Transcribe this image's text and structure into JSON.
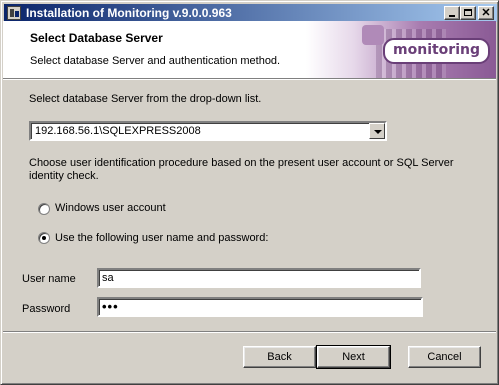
{
  "window": {
    "title": "Installation of Monitoring v.9.0.0.963",
    "controls": {
      "minimize": "",
      "maximize": "",
      "close": "✕"
    }
  },
  "header": {
    "title": "Select Database Server",
    "subtitle": "Select database Server and authentication method.",
    "logo_text": "monitoring"
  },
  "content": {
    "server_prompt": "Select database Server from the drop-down list.",
    "server_selected": "192.168.56.1\\SQLEXPRESS2008",
    "auth_prompt_line1": "Choose user identification procedure based on the present user account or SQL Server",
    "auth_prompt_line2": "identity check.",
    "auth_options": [
      {
        "label": "Windows user account",
        "selected": false
      },
      {
        "label": "Use the following user name and password:",
        "selected": true
      }
    ],
    "username_label": "User name",
    "username_value": "sa",
    "password_label": "Password",
    "password_value": "•••"
  },
  "buttons": {
    "back": "Back",
    "next": "Next",
    "cancel": "Cancel"
  },
  "colors": {
    "titlebar_start": "#0a246a",
    "titlebar_end": "#a6caf0",
    "dialog_bg": "#d4d0c8",
    "brand": "#6a3f78"
  }
}
